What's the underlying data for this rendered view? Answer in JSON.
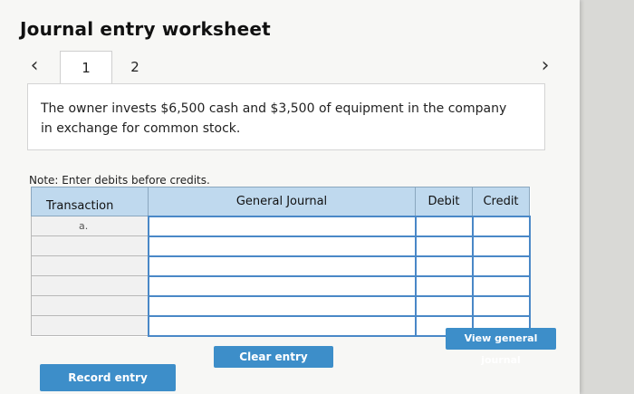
{
  "worksheet": {
    "title": "Journal entry worksheet",
    "nav": {
      "prev_icon": "chevron-left-icon",
      "next_icon": "chevron-right-icon"
    },
    "tabs": [
      {
        "label": "1",
        "active": true
      },
      {
        "label": "2",
        "active": false
      }
    ],
    "prompt": "The owner invests $6,500 cash and $3,500 of equipment in the company in exchange for common stock.",
    "note": "Note: Enter debits before credits."
  },
  "journal": {
    "headers": {
      "transaction": "Transaction",
      "general_journal": "General Journal",
      "debit": "Debit",
      "credit": "Credit"
    },
    "rows": [
      {
        "transaction": "a."
      },
      {
        "transaction": ""
      },
      {
        "transaction": ""
      },
      {
        "transaction": ""
      },
      {
        "transaction": ""
      },
      {
        "transaction": ""
      }
    ]
  },
  "buttons": {
    "record": "Record entry",
    "clear": "Clear entry",
    "view": "View general journal"
  },
  "colors": {
    "header_bg": "#bfd9ee",
    "button_bg": "#3d8ec9",
    "input_border": "#4a88c7"
  }
}
